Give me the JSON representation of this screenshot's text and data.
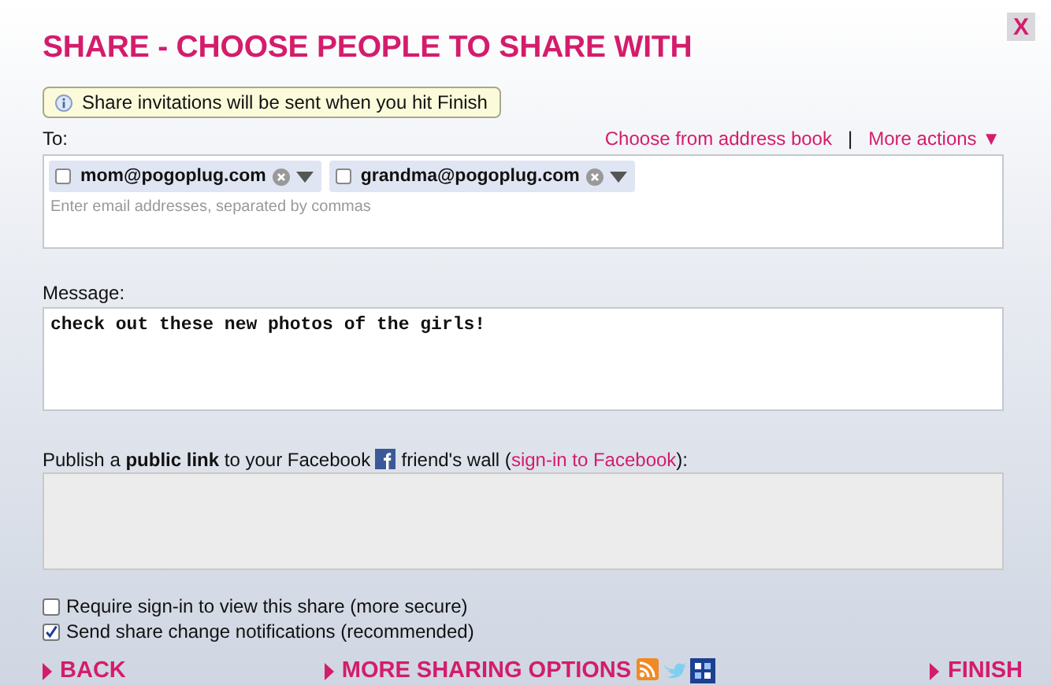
{
  "title": "SHARE - CHOOSE PEOPLE TO SHARE WITH",
  "close": "X",
  "notice": "Share invitations will be sent when you hit Finish",
  "to": {
    "label": "To:",
    "address_book": "Choose from address book",
    "separator": "|",
    "more_actions": "More actions ▼",
    "recipients": [
      {
        "email": "mom@pogoplug.com",
        "checked": false
      },
      {
        "email": "grandma@pogoplug.com",
        "checked": false
      }
    ],
    "placeholder": "Enter email addresses, separated by commas"
  },
  "message": {
    "label": "Message:",
    "value": "check out these new photos of the girls!"
  },
  "publish": {
    "before": "Publish a **public link** to your Facebook",
    "after": " friend's wall (",
    "link": "sign-in to Facebook",
    "end": "):"
  },
  "options": [
    {
      "label": "Require sign-in to view this share (more secure)",
      "checked": false
    },
    {
      "label": "Send share change notifications (recommended)",
      "checked": true
    }
  ],
  "footer": {
    "back": "BACK",
    "more": "MORE SHARING OPTIONS",
    "finish": "FINISH"
  }
}
